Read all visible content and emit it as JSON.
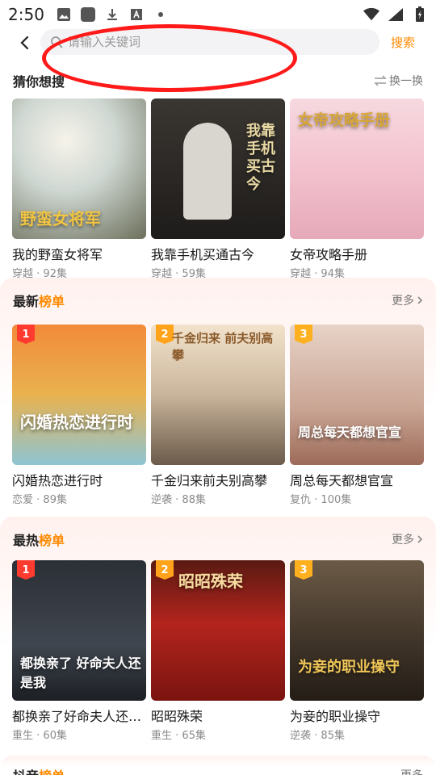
{
  "status_bar": {
    "time": "2:50"
  },
  "search": {
    "placeholder": "请输入关键词",
    "button_label": "搜索"
  },
  "guess": {
    "title": "猜你想搜",
    "action_label": "换一换",
    "items": [
      {
        "title": "我的野蛮女将军",
        "genre": "穿越",
        "episodes": "92集",
        "poster_text": "野蛮女将军"
      },
      {
        "title": "我靠手机买通古今",
        "genre": "穿越",
        "episodes": "59集",
        "poster_text": "我靠手机买古今"
      },
      {
        "title": "女帝攻略手册",
        "genre": "穿越",
        "episodes": "94集",
        "poster_text": "女帝攻略手册"
      }
    ]
  },
  "latest": {
    "title_prefix": "最新",
    "title_accent": "榜单",
    "more_label": "更多",
    "items": [
      {
        "rank": "1",
        "title": "闪婚热恋进行时",
        "genre": "恋爱",
        "episodes": "89集",
        "poster_text": "闪婚热恋进行时"
      },
      {
        "rank": "2",
        "title": "千金归来前夫别高攀",
        "genre": "逆袭",
        "episodes": "88集",
        "poster_text": "千金归来 前夫别高攀"
      },
      {
        "rank": "3",
        "title": "周总每天都想官宣",
        "genre": "复仇",
        "episodes": "100集",
        "poster_text": "周总每天都想官宣"
      }
    ]
  },
  "hottest": {
    "title_prefix": "最热",
    "title_accent": "榜单",
    "more_label": "更多",
    "items": [
      {
        "rank": "1",
        "title": "都换亲了好命夫人还是我",
        "genre": "重生",
        "episodes": "60集",
        "poster_text": "都换亲了 好命夫人还是我"
      },
      {
        "rank": "2",
        "title": "昭昭殊荣",
        "genre": "重生",
        "episodes": "65集",
        "poster_text": "昭昭殊荣"
      },
      {
        "rank": "3",
        "title": "为妾的职业操守",
        "genre": "逆袭",
        "episodes": "85集",
        "poster_text": "为妾的职业操守"
      }
    ]
  },
  "next_section": {
    "title_prefix": "抖音",
    "title_accent": "榜单",
    "more_label": "更多"
  },
  "colors": {
    "accent": "#ff8a00",
    "rank1": "#ff3b30",
    "rank2": "#ffa31a",
    "rank3": "#ffb01f",
    "annotation": "#ff1a1a"
  }
}
